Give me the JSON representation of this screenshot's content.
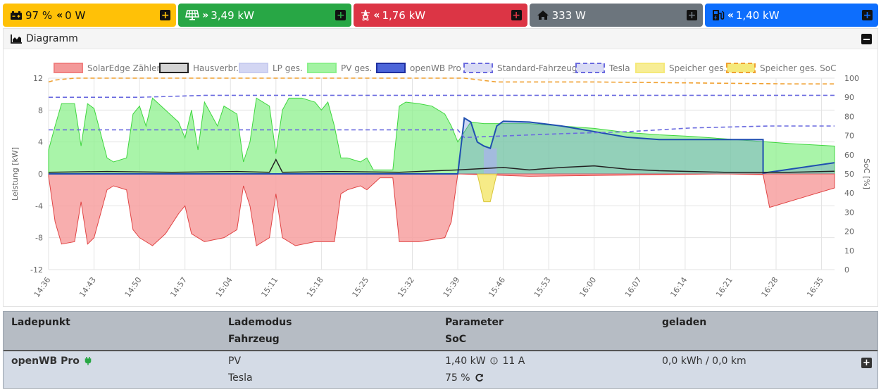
{
  "tiles": {
    "battery": {
      "soc": "97 %",
      "power": "0 W",
      "icon": "car-battery-icon"
    },
    "pv": {
      "power": "3,49 kW",
      "icon": "solar-panel-icon"
    },
    "grid": {
      "power": "1,76 kW",
      "icon": "power-tower-icon"
    },
    "home": {
      "power": "333 W",
      "icon": "home-icon"
    },
    "chargepoint": {
      "power": "1,40 kW",
      "icon": "charging-station-icon"
    },
    "expand_label": "+"
  },
  "chart_card": {
    "title": "Diagramm",
    "collapse_label": "−"
  },
  "chart_data": {
    "type": "line",
    "ylabel_left": "Leistung [kW]",
    "ylabel_right": "SoC [%]",
    "ylim_left": [
      -12,
      12
    ],
    "ylim_right": [
      0,
      100
    ],
    "yticks_left": [
      "12",
      "8",
      "4",
      "0",
      "-4",
      "-8",
      "-12"
    ],
    "yticks_right": [
      "100",
      "90",
      "80",
      "70",
      "60",
      "50",
      "40",
      "30",
      "20",
      "10",
      "0"
    ],
    "x_ticks": [
      "14:36",
      "14:43",
      "14:50",
      "14:57",
      "15:04",
      "15:11",
      "15:18",
      "15:25",
      "15:32",
      "15:39",
      "15:46",
      "15:53",
      "16:00",
      "16:07",
      "16:14",
      "16:21",
      "16:28",
      "16:35"
    ],
    "x_range": [
      "14:36",
      "16:37"
    ],
    "grid": true,
    "legend_position": "top",
    "legend": [
      {
        "name": "SolarEdge Zähler",
        "color": "#f08080",
        "style": "area"
      },
      {
        "name": "Hausverbr.",
        "color": "#222222",
        "style": "area"
      },
      {
        "name": "LP ges.",
        "color": "#c8ccf0",
        "style": "area"
      },
      {
        "name": "PV ges.",
        "color": "#8cf08c",
        "style": "area"
      },
      {
        "name": "openWB Pro",
        "color": "#1f3fcf",
        "style": "area"
      },
      {
        "name": "Standard-Fahrzeug",
        "color": "#6b6bdf",
        "style": "dashed"
      },
      {
        "name": "Tesla",
        "color": "#6b6bdf",
        "style": "dashed"
      },
      {
        "name": "Speicher ges.",
        "color": "#f5e97a",
        "style": "area"
      },
      {
        "name": "Speicher ges. SoC",
        "color": "#f0a030",
        "style": "dashed"
      }
    ],
    "series": [
      {
        "name": "PV ges.",
        "axis": "left",
        "x": [
          "14:36",
          "14:37",
          "14:38",
          "14:40",
          "14:41",
          "14:42",
          "14:43",
          "14:45",
          "14:46",
          "14:48",
          "14:49",
          "14:50",
          "14:51",
          "14:52",
          "14:54",
          "14:56",
          "14:57",
          "14:58",
          "14:59",
          "15:00",
          "15:02",
          "15:03",
          "15:05",
          "15:06",
          "15:07",
          "15:08",
          "15:10",
          "15:11",
          "15:12",
          "15:13",
          "15:15",
          "15:17",
          "15:18",
          "15:19",
          "15:20",
          "15:21",
          "15:22",
          "15:24",
          "15:25",
          "15:26",
          "15:27",
          "15:29",
          "15:30",
          "15:31",
          "15:33",
          "15:35",
          "15:37",
          "15:38",
          "15:39",
          "15:41",
          "15:43",
          "15:45",
          "15:50",
          "15:55",
          "16:00",
          "16:05",
          "16:10",
          "16:15",
          "16:20",
          "16:25",
          "16:30",
          "16:37"
        ],
        "values": [
          3.0,
          6.0,
          8.8,
          8.8,
          3.5,
          8.8,
          8.2,
          2.0,
          1.5,
          2.0,
          7.5,
          8.5,
          6.0,
          9.5,
          8.0,
          6.5,
          4.5,
          8.0,
          3.0,
          9.0,
          6.0,
          8.5,
          7.5,
          1.5,
          4.0,
          9.5,
          8.5,
          2.5,
          8.0,
          9.5,
          9.5,
          9.0,
          8.0,
          9.0,
          6.0,
          2.0,
          2.0,
          1.5,
          2.0,
          0.5,
          0.5,
          0.5,
          8.5,
          9.0,
          8.8,
          8.5,
          7.5,
          6.0,
          4.0,
          6.5,
          6.3,
          6.3,
          6.3,
          6.0,
          5.7,
          5.2,
          4.9,
          4.7,
          4.4,
          4.1,
          3.8,
          3.49
        ]
      },
      {
        "name": "SolarEdge Zähler",
        "axis": "left",
        "x": [
          "14:36",
          "14:37",
          "14:38",
          "14:40",
          "14:41",
          "14:42",
          "14:43",
          "14:45",
          "14:46",
          "14:48",
          "14:49",
          "14:50",
          "14:52",
          "14:54",
          "14:56",
          "14:57",
          "14:58",
          "15:00",
          "15:03",
          "15:05",
          "15:06",
          "15:07",
          "15:08",
          "15:10",
          "15:11",
          "15:12",
          "15:14",
          "15:17",
          "15:20",
          "15:21",
          "15:22",
          "15:24",
          "15:25",
          "15:27",
          "15:29",
          "15:30",
          "15:31",
          "15:33",
          "15:37",
          "15:38",
          "15:39",
          "15:50",
          "16:00",
          "16:10",
          "16:20",
          "16:26",
          "16:27",
          "16:37"
        ],
        "values": [
          -0.3,
          -6.0,
          -8.8,
          -8.5,
          -3.5,
          -8.8,
          -8.0,
          -2.0,
          -1.5,
          -2.0,
          -7.0,
          -8.0,
          -9.0,
          -7.5,
          -5.0,
          -4.0,
          -7.5,
          -8.5,
          -8.0,
          -7.0,
          -1.5,
          -4.0,
          -9.0,
          -8.0,
          -2.5,
          -8.0,
          -9.0,
          -8.5,
          -8.5,
          -2.5,
          -2.0,
          -1.5,
          -2.0,
          -0.5,
          -0.5,
          -8.5,
          -8.5,
          -8.5,
          -8.0,
          -6.0,
          0.0,
          -0.3,
          -0.2,
          -0.1,
          0.0,
          -0.1,
          -4.2,
          -1.76
        ]
      },
      {
        "name": "openWB Pro",
        "axis": "left",
        "x": [
          "14:36",
          "15:39",
          "15:40",
          "15:41",
          "15:42",
          "15:43",
          "15:44",
          "15:45",
          "15:46",
          "15:50",
          "15:55",
          "16:00",
          "16:05",
          "16:10",
          "16:15",
          "16:20",
          "16:26",
          "16:26",
          "16:37"
        ],
        "values": [
          0,
          0,
          7.0,
          6.5,
          4.0,
          3.5,
          3.2,
          6.0,
          6.6,
          6.5,
          6.0,
          5.3,
          4.6,
          4.3,
          4.3,
          4.3,
          4.3,
          0.1,
          1.4
        ]
      },
      {
        "name": "Hausverbr.",
        "axis": "left",
        "x": [
          "14:36",
          "14:45",
          "14:55",
          "15:05",
          "15:10",
          "15:11",
          "15:12",
          "15:20",
          "15:30",
          "15:39",
          "15:46",
          "15:50",
          "15:55",
          "16:00",
          "16:05",
          "16:10",
          "16:20",
          "16:30",
          "16:37"
        ],
        "values": [
          0.2,
          0.3,
          0.2,
          0.3,
          0.2,
          1.8,
          0.2,
          0.3,
          0.2,
          0.5,
          0.8,
          0.5,
          0.8,
          1.0,
          0.6,
          0.4,
          0.2,
          0.2,
          0.33
        ]
      },
      {
        "name": "LP ges.",
        "axis": "left",
        "x": [
          "15:43",
          "15:45"
        ],
        "values": [
          3.2,
          3.2
        ]
      },
      {
        "name": "Speicher ges.",
        "axis": "left",
        "x": [
          "15:42",
          "15:43",
          "15:44",
          "15:45"
        ],
        "values": [
          0,
          -3.5,
          -3.5,
          0
        ]
      },
      {
        "name": "Speicher ges. SoC",
        "axis": "right",
        "x": [
          "14:36",
          "14:37",
          "14:40",
          "15:00",
          "15:40",
          "15:45",
          "16:00",
          "16:30",
          "16:37"
        ],
        "values": [
          98,
          99,
          100,
          100,
          100,
          98,
          98,
          97,
          97
        ]
      },
      {
        "name": "Standard-Fahrzeug",
        "axis": "right",
        "x": [
          "14:36",
          "14:50",
          "15:00",
          "16:37"
        ],
        "values": [
          90,
          90,
          91,
          91
        ]
      },
      {
        "name": "Tesla",
        "axis": "right",
        "x": [
          "14:36",
          "15:39",
          "15:40",
          "15:55",
          "16:05",
          "16:10",
          "16:15",
          "16:27",
          "16:37"
        ],
        "values": [
          73,
          73,
          69,
          71,
          72,
          73,
          74,
          75,
          75
        ]
      }
    ]
  },
  "table": {
    "headers": {
      "col1": "Ladepunkt",
      "col2_line1": "Lademodus",
      "col2_line2": "Fahrzeug",
      "col3_line1": "Parameter",
      "col3_line2": "SoC",
      "col4": "geladen"
    },
    "row": {
      "name": "openWB Pro",
      "mode": "PV",
      "vehicle": "Tesla",
      "power": "1,40 kW",
      "current": "11 A",
      "soc": "75 %",
      "charged": "0,0 kWh / 0,0 km",
      "expand_label": "+"
    }
  }
}
